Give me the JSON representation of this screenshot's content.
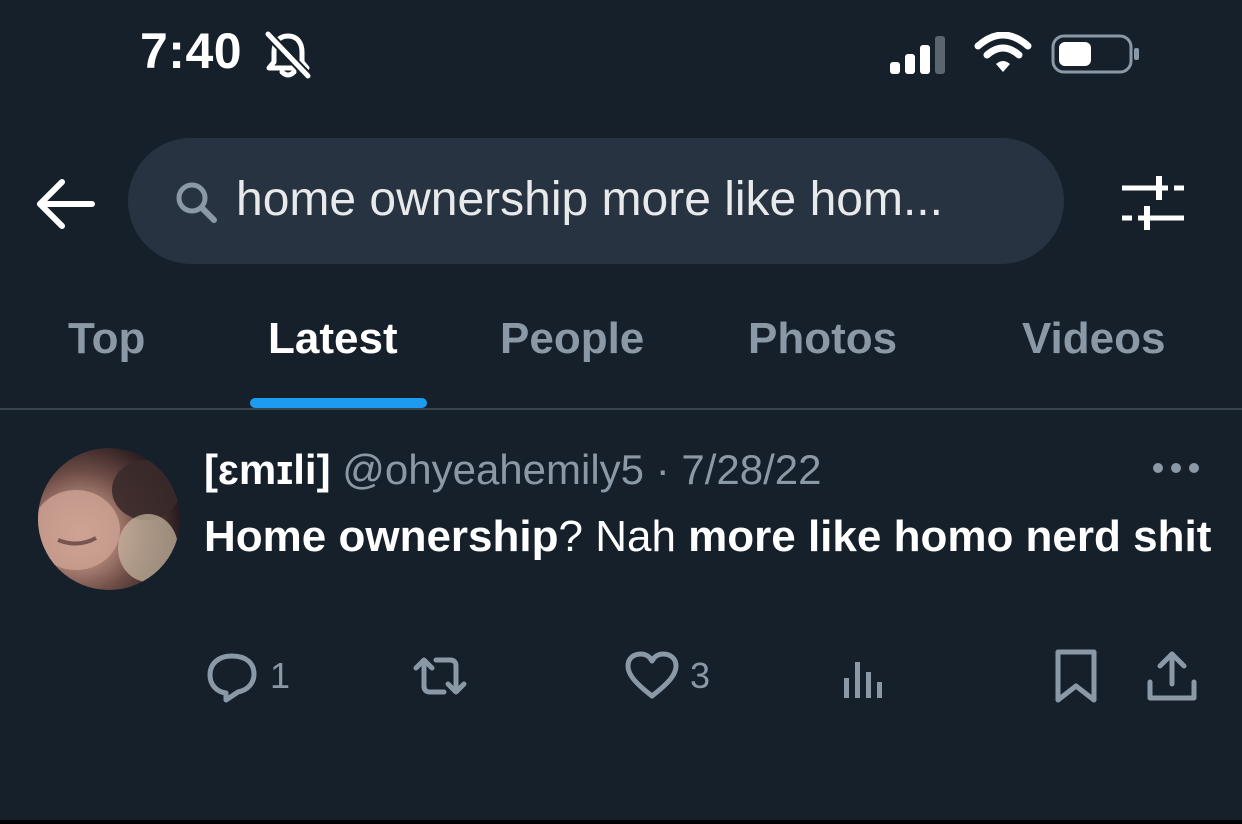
{
  "status_bar": {
    "time": "7:40"
  },
  "search": {
    "query": "home ownership more like hom..."
  },
  "tabs": [
    {
      "label": "Top",
      "active": false
    },
    {
      "label": "Latest",
      "active": true
    },
    {
      "label": "People",
      "active": false
    },
    {
      "label": "Photos",
      "active": false
    },
    {
      "label": "Videos",
      "active": false
    }
  ],
  "tweet": {
    "display_name": "[ɛmɪli]",
    "handle": "@ohyeahemily5",
    "separator": "·",
    "date": "7/28/22",
    "body": {
      "part1": "Home ownership",
      "part2": "? Nah ",
      "part3": "more like homo nerd shit"
    },
    "replies": "1",
    "likes": "3"
  },
  "colors": {
    "background": "#15202b",
    "accent": "#1d9bf0",
    "muted": "#8b98a5"
  },
  "icons": [
    "bell-slash-icon",
    "signal-icon",
    "wifi-icon",
    "battery-icon",
    "back-arrow-icon",
    "search-icon",
    "filter-icon",
    "more-icon",
    "reply-icon",
    "retweet-icon",
    "like-icon",
    "views-icon",
    "bookmark-icon",
    "share-icon"
  ]
}
